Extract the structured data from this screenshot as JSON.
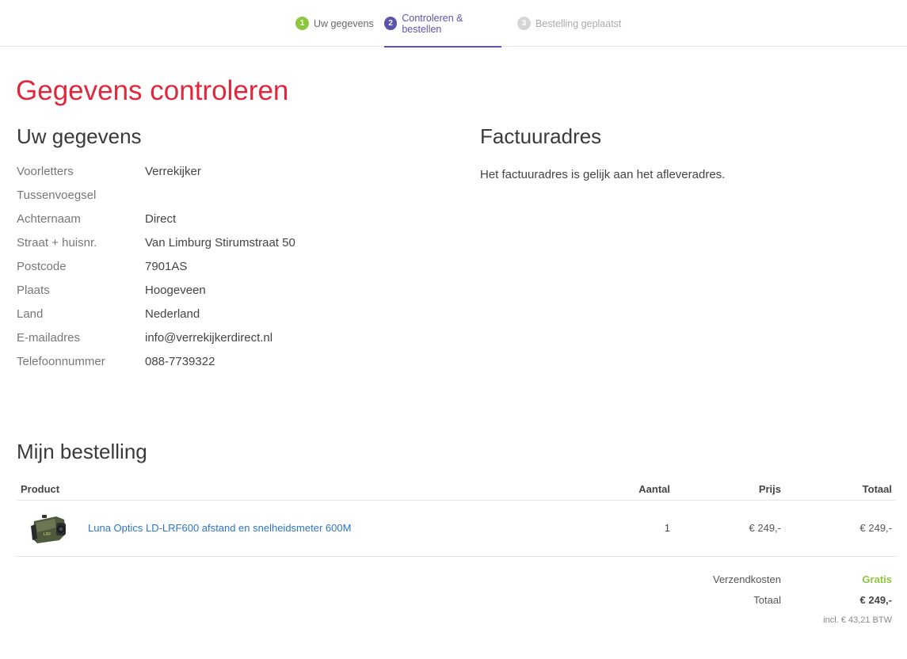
{
  "stepper": {
    "steps": [
      {
        "num": "1",
        "label": "Uw gegevens"
      },
      {
        "num": "2",
        "label": "Controleren & bestellen"
      },
      {
        "num": "3",
        "label": "Bestelling geplaatst"
      }
    ],
    "active_step": 2
  },
  "page_title": "Gegevens controleren",
  "gegevens": {
    "title": "Uw gegevens",
    "rows": [
      {
        "label": "Voorletters",
        "value": "Verrekijker"
      },
      {
        "label": "Tussenvoegsel",
        "value": ""
      },
      {
        "label": "Achternaam",
        "value": "Direct"
      },
      {
        "label": "Straat + huisnr.",
        "value": "Van Limburg Stirumstraat 50"
      },
      {
        "label": "Postcode",
        "value": "7901AS"
      },
      {
        "label": "Plaats",
        "value": "Hoogeveen"
      },
      {
        "label": "Land",
        "value": "Nederland"
      },
      {
        "label": "E-mailadres",
        "value": "info@verrekijkerdirect.nl"
      },
      {
        "label": "Telefoonnummer",
        "value": "088-7739322"
      }
    ]
  },
  "factuur": {
    "title": "Factuuradres",
    "text": "Het factuuradres is gelijk aan het afleveradres."
  },
  "bestelling": {
    "title": "Mijn bestelling",
    "headers": {
      "product": "Product",
      "aantal": "Aantal",
      "prijs": "Prijs",
      "totaal": "Totaal"
    },
    "items": [
      {
        "name": "Luna Optics LD-LRF600 afstand en snelheidsmeter 600M",
        "qty": "1",
        "price": "€ 249,-",
        "total": "€ 249,-"
      }
    ],
    "summary": {
      "shipping_label": "Verzendkosten",
      "shipping_value": "Gratis",
      "total_label": "Totaal",
      "total_value": "€ 249,-",
      "vat": "incl. € 43,21 BTW"
    }
  },
  "colors": {
    "title": "#e0283d",
    "active_step": "#5a55a8",
    "done_step": "#8dc63f",
    "link": "#2f75c6",
    "free": "#8dc63f"
  }
}
